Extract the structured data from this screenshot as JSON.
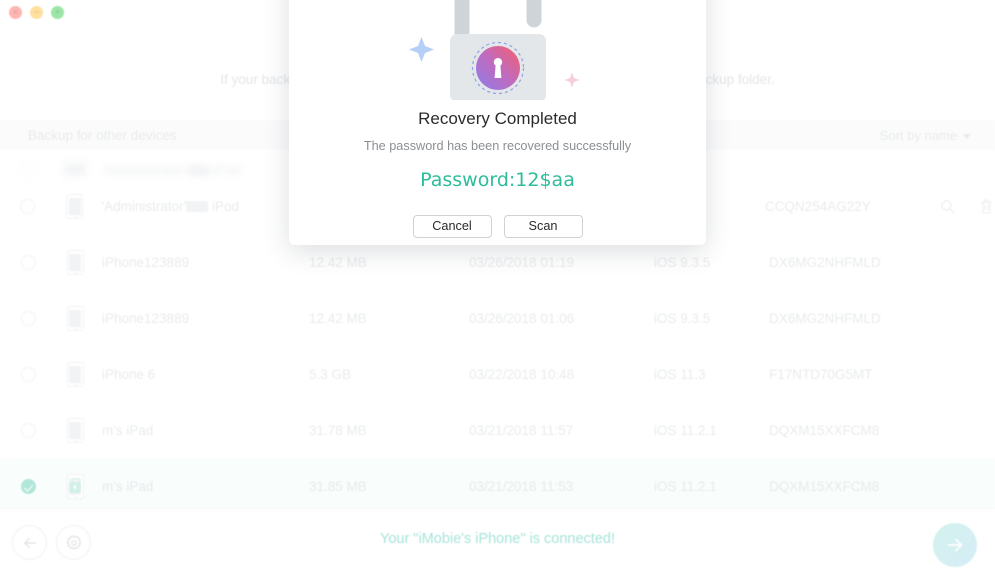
{
  "window": {
    "controls": [
      {
        "name": "close",
        "glyph": "×",
        "color": "#ff5f57"
      },
      {
        "name": "minimize",
        "glyph": "−",
        "color": "#ffbd2e"
      },
      {
        "name": "maximize",
        "glyph": "+",
        "color": "#28c940"
      }
    ]
  },
  "hint": {
    "left_text": "If your backup i",
    "right_text": "a backup folder."
  },
  "list_header": {
    "title": "Backup for other devices",
    "sort_label": "Sort by name"
  },
  "rows": [
    {
      "name": "‘Administrator’",
      "name_suffix": "iPod",
      "size": "",
      "date": "",
      "version": "",
      "serial": "",
      "selected": false,
      "locked": false,
      "clipped": true,
      "device": "wide",
      "redacted": true,
      "ghosted": true
    },
    {
      "name": "'Administrator'",
      "name_suffix": "iPod",
      "size": "",
      "date": "",
      "version": "",
      "serial": "CCQN254AG22Y",
      "selected": false,
      "locked": false,
      "clipped": false,
      "device": "tall",
      "redacted": true,
      "ghosted": false,
      "has_actions": true
    },
    {
      "name": "iPhone123889",
      "name_suffix": "",
      "size": "12.42 MB",
      "date": "03/26/2018 01:19",
      "version": "iOS 9.3.5",
      "serial": "DX6MG2NHFMLD",
      "selected": false,
      "locked": false,
      "clipped": false,
      "device": "tall",
      "redacted": false,
      "ghosted": false
    },
    {
      "name": "iPhone123889",
      "name_suffix": "",
      "size": "12.42 MB",
      "date": "03/26/2018 01:06",
      "version": "iOS 9.3.5",
      "serial": "DX6MG2NHFMLD",
      "selected": false,
      "locked": false,
      "clipped": false,
      "device": "tall",
      "redacted": false,
      "ghosted": false
    },
    {
      "name": "iPhone 6",
      "name_suffix": "",
      "size": "5.3 GB",
      "date": "03/22/2018 10:48",
      "version": "iOS 11.3",
      "serial": "F17NTD70G5MT",
      "selected": false,
      "locked": false,
      "clipped": false,
      "device": "tall",
      "redacted": false,
      "ghosted": false
    },
    {
      "name": "m's iPad",
      "name_suffix": "",
      "size": "31.78 MB",
      "date": "03/21/2018 11:57",
      "version": "iOS 11.2.1",
      "serial": "DQXM15XXFCM8",
      "selected": false,
      "locked": false,
      "clipped": false,
      "device": "tall",
      "redacted": false,
      "ghosted": false
    },
    {
      "name": "m's iPad",
      "name_suffix": "",
      "size": "31.85 MB",
      "date": "03/21/2018 11:53",
      "version": "iOS 11.2.1",
      "serial": "DQXM15XXFCM8",
      "selected": true,
      "locked": true,
      "clipped": false,
      "device": "tall",
      "redacted": false,
      "ghosted": false
    }
  ],
  "bottom": {
    "status_text": "Your \"iMobie's iPhone\" is connected!",
    "back_icon": "arrow-left-icon",
    "settings_icon": "gear-icon",
    "next_icon": "arrow-right-icon",
    "accent_color": "#3ec6ad"
  },
  "dialog": {
    "title": "Recovery Completed",
    "subtitle": "The password has been recovered successfully",
    "password": "Password:12$aa",
    "password_color": "#2dbd9a",
    "cancel_label": "Cancel",
    "scan_label": "Scan",
    "icon": "unlocked-padlock-icon"
  }
}
